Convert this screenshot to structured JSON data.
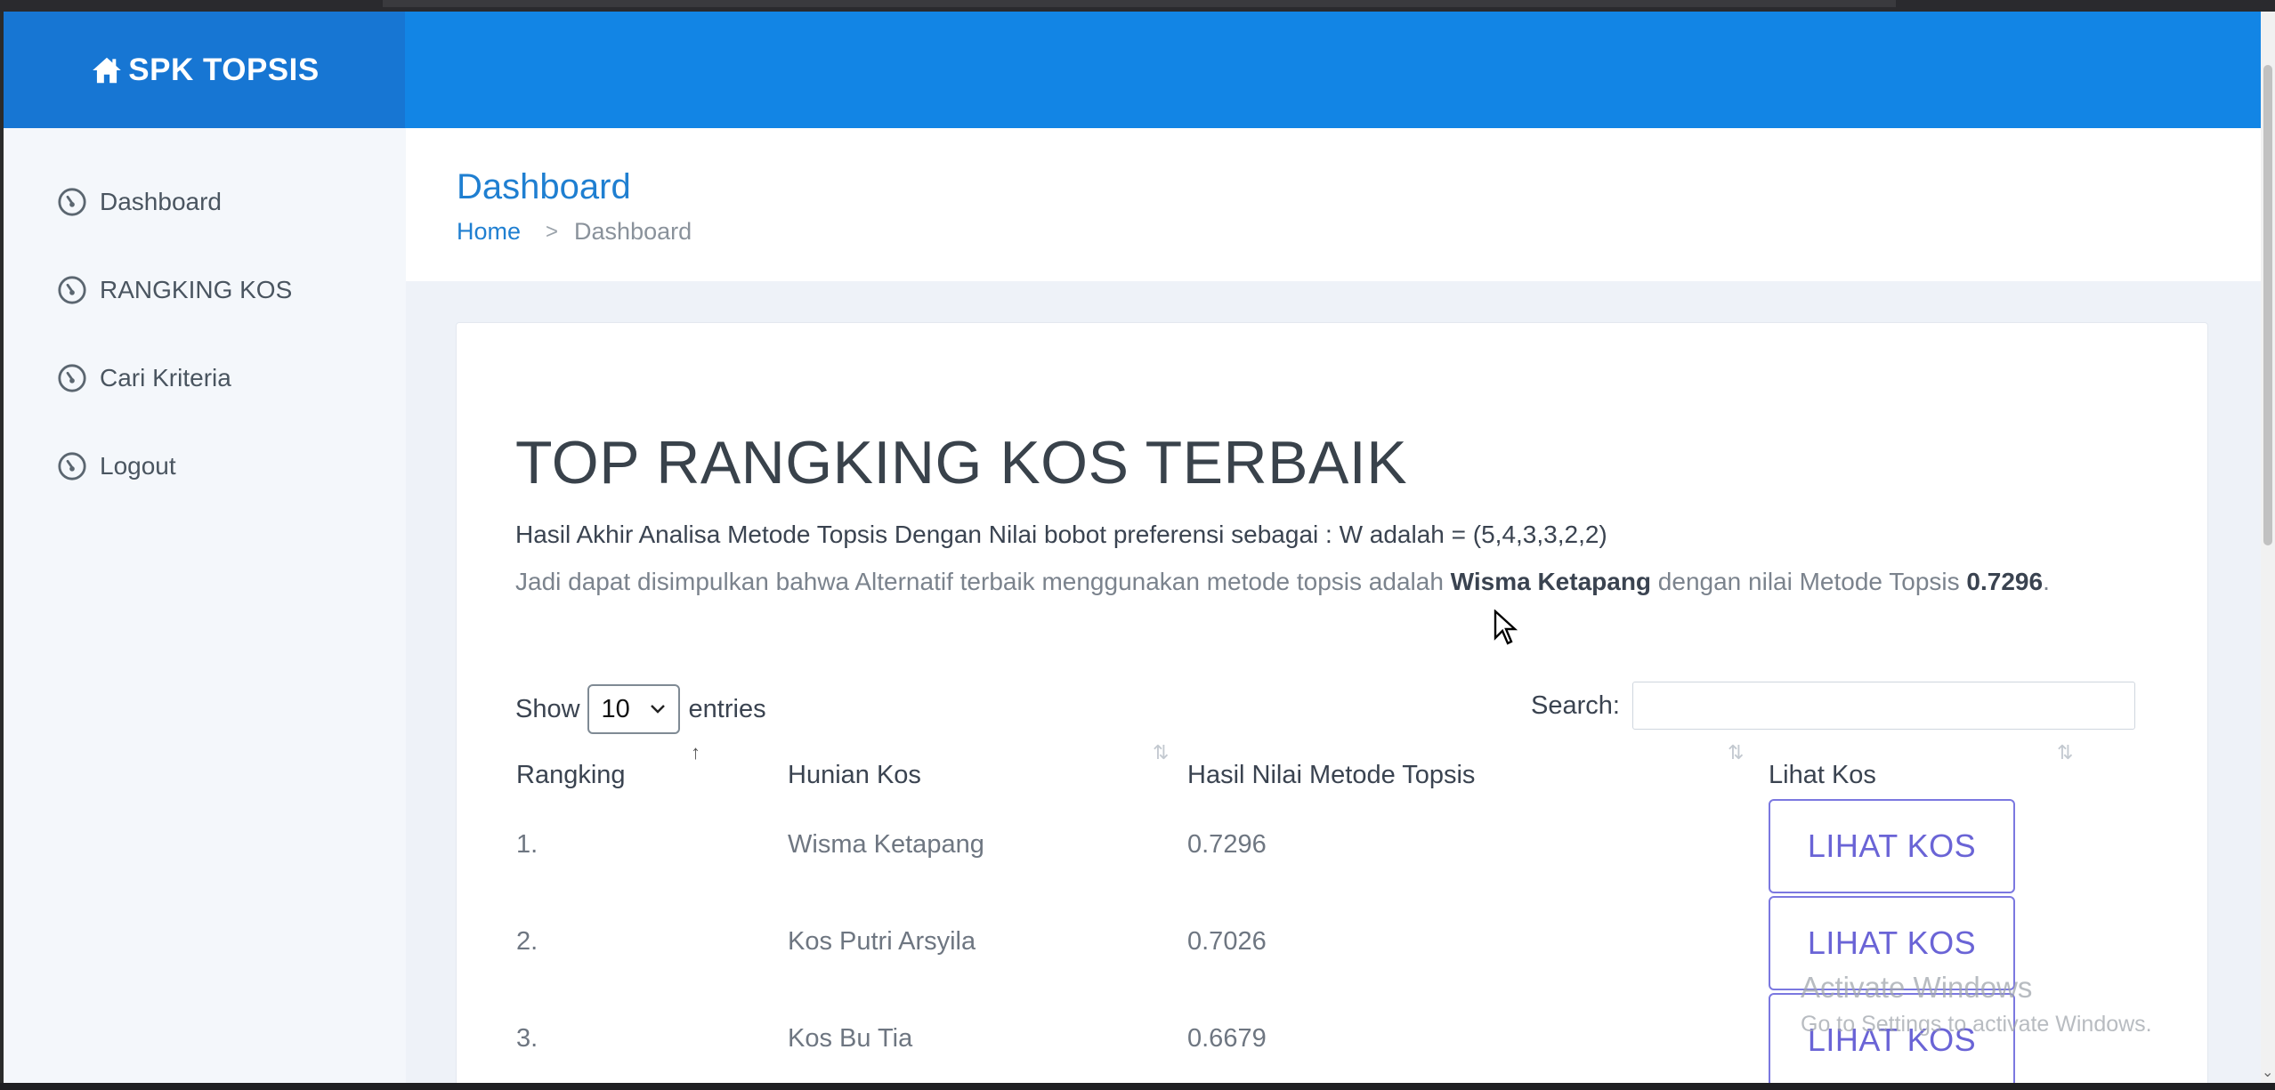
{
  "brand": {
    "title": "SPK TOPSIS",
    "icon": "home-icon"
  },
  "sidebar": {
    "items": [
      {
        "label": "Dashboard",
        "icon": "gauge-icon"
      },
      {
        "label": "RANGKING KOS",
        "icon": "gauge-icon"
      },
      {
        "label": "Cari Kriteria",
        "icon": "gauge-icon"
      },
      {
        "label": "Logout",
        "icon": "gauge-icon"
      }
    ]
  },
  "header": {
    "title": "Dashboard",
    "breadcrumb": {
      "home": "Home",
      "separator": ">",
      "current": "Dashboard"
    }
  },
  "card": {
    "title": "TOP RANGKING KOS TERBAIK",
    "summary_line1": "Hasil Akhir Analisa Metode Topsis Dengan Nilai bobot preferensi sebagai : W adalah = (5,4,3,3,2,2)",
    "summary_line2_prefix": "Jadi dapat disimpulkan bahwa Alternatif terbaik menggunakan metode topsis adalah ",
    "summary_best": "Wisma Ketapang",
    "summary_line2_mid": " dengan nilai Metode Topsis ",
    "summary_value": "0.7296",
    "summary_line2_suffix": "."
  },
  "controls": {
    "show_label": "Show",
    "entries_value": "10",
    "entries_label": "entries",
    "search_label": "Search:",
    "search_value": ""
  },
  "table": {
    "columns": [
      "Rangking",
      "Hunian Kos",
      "Hasil Nilai Metode Topsis",
      "Lihat Kos"
    ],
    "rows": [
      {
        "rank": "1.",
        "name": "Wisma Ketapang",
        "score": "0.7296",
        "action": "LIHAT KOS"
      },
      {
        "rank": "2.",
        "name": "Kos Putri Arsyila",
        "score": "0.7026",
        "action": "LIHAT KOS"
      },
      {
        "rank": "3.",
        "name": "Kos Bu Tia",
        "score": "0.6679",
        "action": "LIHAT KOS"
      }
    ]
  },
  "watermark": {
    "line1": "Activate Windows",
    "line2": "Go to Settings to activate Windows."
  },
  "colors": {
    "navbar": "#1285e5",
    "brand_bg": "#1776d3",
    "accent": "#1f7fd1",
    "button": "#6a64d6"
  }
}
